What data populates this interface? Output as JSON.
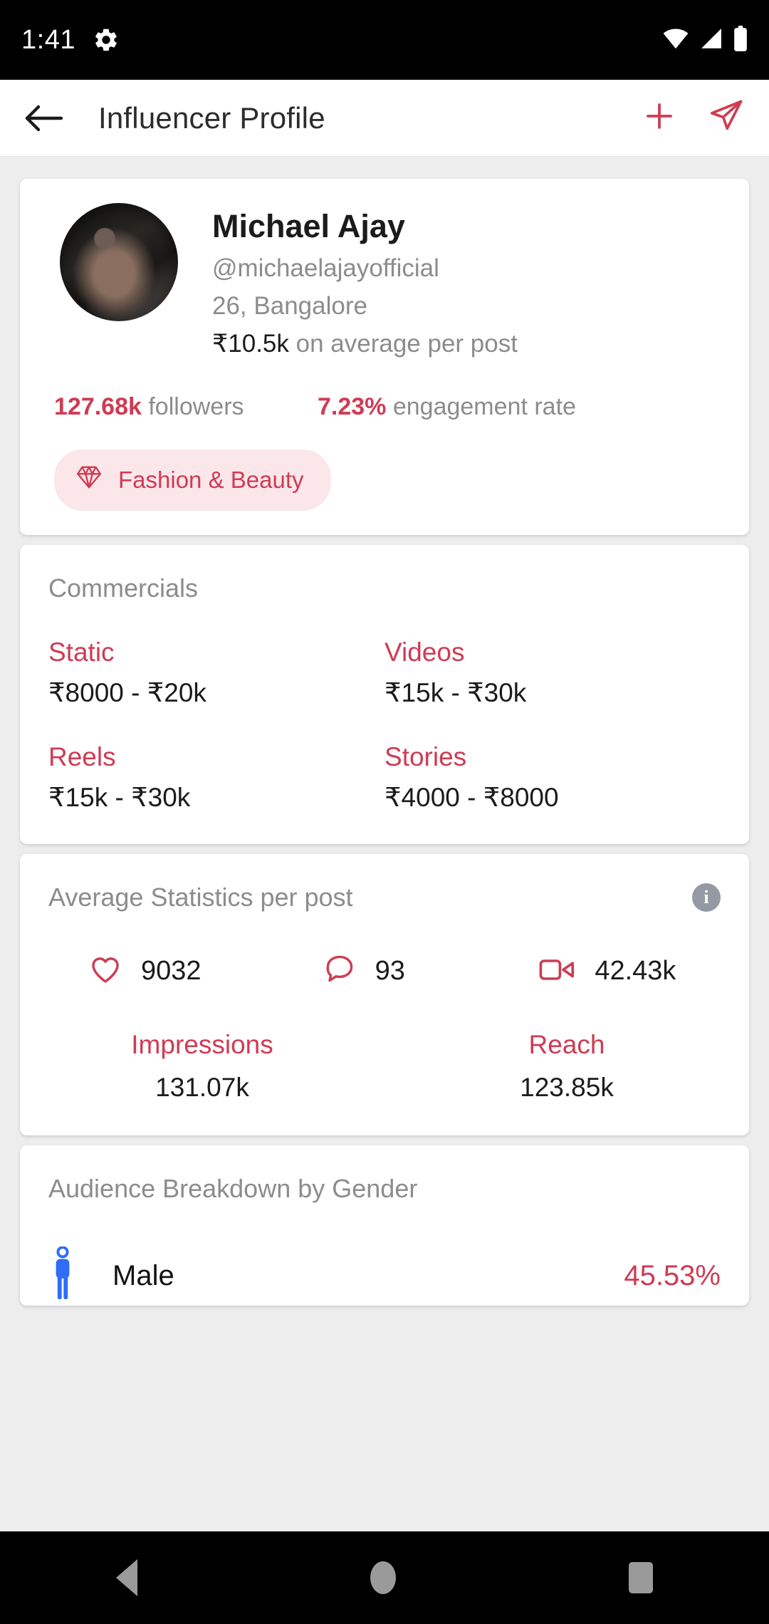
{
  "status_bar": {
    "time": "1:41",
    "icons": [
      "gear-icon",
      "wifi-icon",
      "signal-icon",
      "battery-icon"
    ]
  },
  "app_bar": {
    "title": "Influencer Profile",
    "back_icon": "back-arrow-icon",
    "add_icon": "plus-icon",
    "share_icon": "send-icon",
    "accent_color": "#cf3b53"
  },
  "profile": {
    "name": "Michael Ajay",
    "handle": "@michaelajayofficial",
    "location": "26, Bangalore",
    "avg_rate_value": "₹10.5k",
    "avg_rate_suffix": " on average per post",
    "followers_value": "127.68k",
    "followers_label": " followers",
    "engagement_value": "7.23%",
    "engagement_label": " engagement rate",
    "niche": "Fashion & Beauty",
    "niche_icon": "diamond-icon"
  },
  "commercials": {
    "title": "Commercials",
    "items": [
      {
        "label": "Static",
        "value": "₹8000 - ₹20k"
      },
      {
        "label": "Videos",
        "value": "₹15k - ₹30k"
      },
      {
        "label": "Reels",
        "value": "₹15k - ₹30k"
      },
      {
        "label": "Stories",
        "value": "₹4000 - ₹8000"
      }
    ]
  },
  "statistics": {
    "title": "Average Statistics per post",
    "info_badge": "i",
    "icon_stats": [
      {
        "icon": "heart-icon",
        "value": "9032"
      },
      {
        "icon": "comment-icon",
        "value": "93"
      },
      {
        "icon": "video-icon",
        "value": "42.43k"
      }
    ],
    "detail_stats": [
      {
        "label": "Impressions",
        "value": "131.07k"
      },
      {
        "label": "Reach",
        "value": "123.85k"
      }
    ]
  },
  "audience": {
    "title": "Audience Breakdown by Gender",
    "rows": [
      {
        "icon": "male-icon",
        "label": "Male",
        "percent": "45.53%"
      }
    ]
  },
  "nav_bar": {
    "back": "nav-back-icon",
    "home": "nav-home-icon",
    "recents": "nav-recents-icon"
  }
}
